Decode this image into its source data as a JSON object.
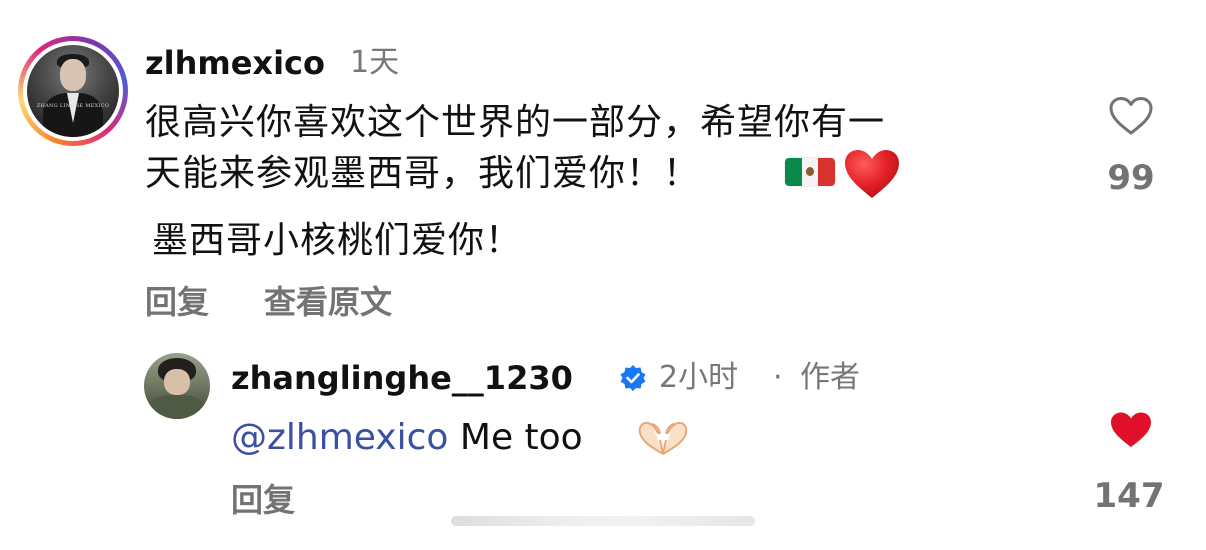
{
  "comment": {
    "username": "zlhmexico",
    "time": "1天",
    "line1": "很高兴你喜欢这个世界的一部分，希望你有一",
    "line2": "天能来参观墨西哥，我们爱你！！",
    "line3": "墨西哥小核桃们爱你！",
    "reply_label": "回复",
    "see_original_label": "查看原文",
    "like_count": "99",
    "avatar_caption": "ZHANG LINGHE MEXICO"
  },
  "reply": {
    "username": "zhanglinghe__1230",
    "time": "2小时",
    "separator": "·",
    "author_badge": "作者",
    "mention": "@zlhmexico",
    "text": "Me too",
    "reply_label": "回复",
    "like_count": "147"
  },
  "colors": {
    "text": "#111111",
    "muted": "#737373",
    "mention": "#3b4fa3",
    "liked_heart": "#e0102a",
    "verified": "#1877f2"
  },
  "icons": {
    "parent_like": "heart-outline-icon",
    "reply_like": "heart-filled-icon",
    "verified": "verified-badge-icon",
    "flag": "mexico-flag-emoji",
    "heart_emoji": "red-heart-emoji",
    "heart_hands": "heart-hands-emoji"
  }
}
